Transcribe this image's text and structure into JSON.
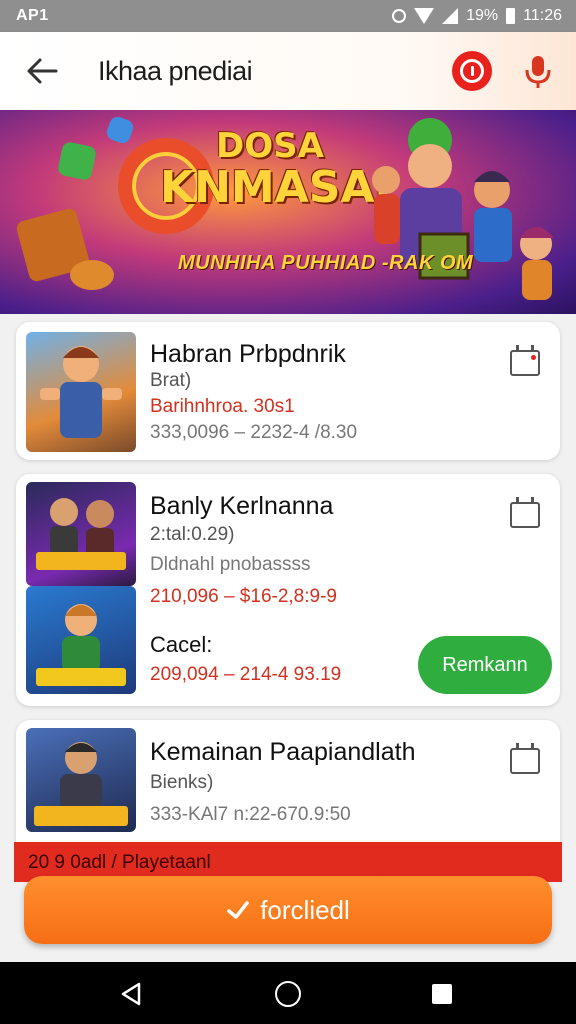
{
  "status_bar": {
    "carrier": "AP1",
    "battery": "19%",
    "time": "11:26"
  },
  "app_bar": {
    "title": "Ikhaa pnediai"
  },
  "banner": {
    "title_line1": "DOSA",
    "title_line2": "KNMASAI",
    "subtitle": "MUNHIHA PUHHIAD -RAK OM"
  },
  "items": [
    {
      "title": "Habran Prbpdnrik",
      "line1": "Brat)",
      "line2": "Barihnhroa. 30s1",
      "line3": "333,0096 – 2232-4 /8.30"
    },
    {
      "title": "Banly Kerlnanna",
      "line1": "2:tal:0.29)",
      "line2": "Dldnahl pnobassss",
      "line3": "210,096 – $16-2,8:9-9",
      "line4": "Cacel:",
      "line5": "209,094 – 214-4 93.19",
      "button_label": "Remkann"
    },
    {
      "title": "Kemainan Paapiandlath",
      "line1": "Bienks)",
      "line2": "333-KAl7 n:22-670.9:50"
    }
  ],
  "red_strip": {
    "text": "20 9 0adl / Playetaanl"
  },
  "bottom_button": {
    "label": "forcliedl"
  },
  "colors": {
    "accent_orange": "#f66e13",
    "green": "#2fae3f",
    "red": "#e22b1f",
    "price_red": "#d4301f"
  },
  "icons": [
    "back-arrow-icon",
    "alert-icon",
    "microphone-icon",
    "calendar-icon",
    "check-icon",
    "nav-back-icon",
    "nav-home-icon",
    "nav-recent-icon"
  ]
}
